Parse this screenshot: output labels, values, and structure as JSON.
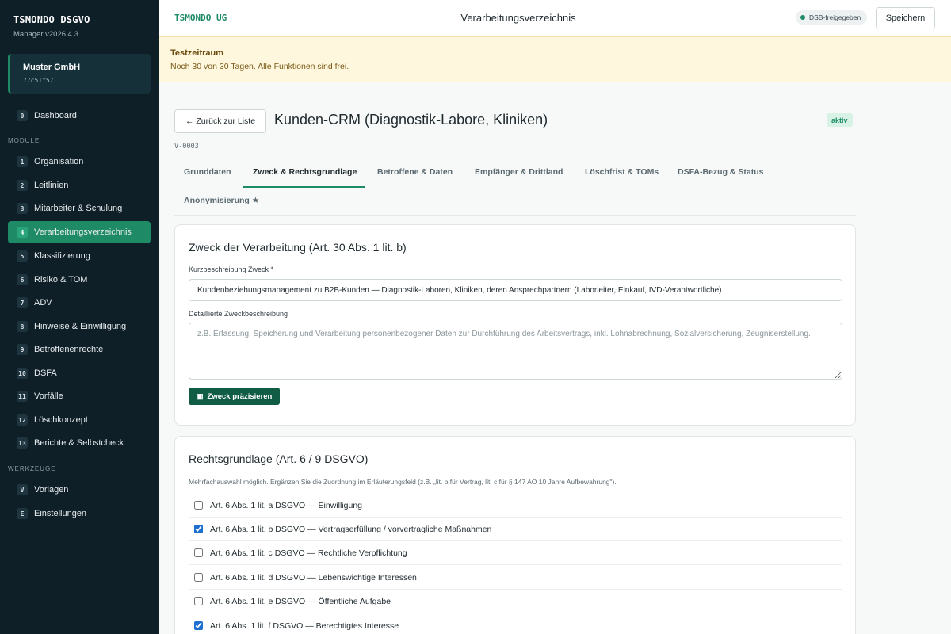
{
  "sidebar": {
    "brand_title": "TSMONDO DSGVO",
    "brand_version": "Manager v2026.4.3",
    "tenant_name": "Muster GmbH",
    "tenant_id": "77c51f57",
    "dashboard": {
      "num": "0",
      "label": "Dashboard"
    },
    "modules_label": "MODULE",
    "modules": [
      {
        "num": "1",
        "label": "Organisation"
      },
      {
        "num": "2",
        "label": "Leitlinien"
      },
      {
        "num": "3",
        "label": "Mitarbeiter & Schulung"
      },
      {
        "num": "4",
        "label": "Verarbeitungsverzeichnis"
      },
      {
        "num": "5",
        "label": "Klassifizierung"
      },
      {
        "num": "6",
        "label": "Risiko & TOM"
      },
      {
        "num": "7",
        "label": "ADV"
      },
      {
        "num": "8",
        "label": "Hinweise & Einwilligung"
      },
      {
        "num": "9",
        "label": "Betroffenenrechte"
      },
      {
        "num": "10",
        "label": "DSFA"
      },
      {
        "num": "11",
        "label": "Vorfälle"
      },
      {
        "num": "12",
        "label": "Löschkonzept"
      },
      {
        "num": "13",
        "label": "Berichte & Selbstcheck"
      }
    ],
    "tools_label": "WERKZEUGE",
    "tools": [
      {
        "num": "V",
        "label": "Vorlagen"
      },
      {
        "num": "E",
        "label": "Einstellungen"
      }
    ]
  },
  "header": {
    "company": "TSMONDO UG",
    "title": "Verarbeitungsverzeichnis",
    "dsb_badge": "DSB-freigegeben",
    "save_label": "Speichern"
  },
  "trial": {
    "title": "Testzeitraum",
    "text": "Noch 30 von 30 Tagen. Alle Funktionen sind frei."
  },
  "record": {
    "back_label": "← Zurück zur Liste",
    "title": "Kunden-CRM (Diagnostik-Labore, Kliniken)",
    "status": "aktiv",
    "id": "V-0003"
  },
  "tabs": [
    "Grunddaten",
    "Zweck & Rechtsgrundlage",
    "Betroffene & Daten",
    "Empfänger & Drittland",
    "Löschfrist & TOMs",
    "DSFA-Bezug & Status",
    "Anonymisierung ★"
  ],
  "purpose": {
    "title": "Zweck der Verarbeitung (Art. 30 Abs. 1 lit. b)",
    "short_label": "Kurzbeschreibung Zweck *",
    "short_value": "Kundenbeziehungsmanagement zu B2B-Kunden — Diagnostik-Laboren, Kliniken, deren Ansprechpartnern (Laborleiter, Einkauf, IVD-Verantwortliche).",
    "detail_label": "Detaillierte Zweckbeschreibung",
    "detail_placeholder": "z.B. Erfassung, Speicherung und Verarbeitung personenbezogener Daten zur Durchführung des Arbeitsvertrags, inkl. Lohnabrechnung, Sozialversicherung, Zeugniserstellung.",
    "refine_label": "Zweck präzisieren"
  },
  "legal": {
    "title": "Rechtsgrundlage (Art. 6 / 9 DSGVO)",
    "hint": "Mehrfachauswahl möglich. Ergänzen Sie die Zuordnung im Erläuterungsfeld (z.B. „lit. b für Vertrag, lit. c für § 147 AO 10 Jahre Aufbewahrung\").",
    "options": [
      {
        "label": "Art. 6 Abs. 1 lit. a DSGVO — Einwilligung",
        "checked": false
      },
      {
        "label": "Art. 6 Abs. 1 lit. b DSGVO — Vertragserfüllung / vorvertragliche Maßnahmen",
        "checked": true
      },
      {
        "label": "Art. 6 Abs. 1 lit. c DSGVO — Rechtliche Verpflichtung",
        "checked": false
      },
      {
        "label": "Art. 6 Abs. 1 lit. d DSGVO — Lebenswichtige Interessen",
        "checked": false
      },
      {
        "label": "Art. 6 Abs. 1 lit. e DSGVO — Öffentliche Aufgabe",
        "checked": false
      },
      {
        "label": "Art. 6 Abs. 1 lit. f DSGVO — Berechtigtes Interesse",
        "checked": true
      }
    ]
  },
  "colors": {
    "sidebar_bg": "#0f1f28",
    "accent": "#1e8a66",
    "primary_button": "#115c44",
    "trial_bg": "#fef7dd"
  }
}
